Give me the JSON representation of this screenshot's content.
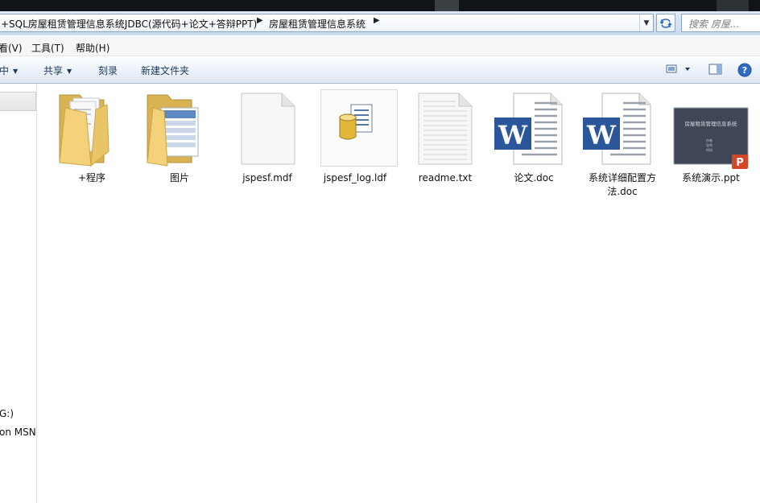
{
  "address": {
    "segment1": "+SQL房屋租赁管理信息系统JDBC(源代码+论文+答辩PPT)",
    "segment2": "房屋租赁管理信息系统",
    "search_placeholder": "搜索 房屋..."
  },
  "menu": [
    "看(V)",
    "工具(T)",
    "帮助(H)"
  ],
  "toolbar": {
    "include": "中",
    "share": "共享",
    "burn": "刻录",
    "new_folder": "新建文件夹"
  },
  "nav": {
    "drive_label": "G:)",
    "msn_label": "on MSN"
  },
  "files": [
    {
      "name": "+程序",
      "kind": "folder"
    },
    {
      "name": "图片",
      "kind": "folder-images"
    },
    {
      "name": "jspesf.mdf",
      "kind": "blank"
    },
    {
      "name": "jspesf_log.ldf",
      "kind": "database"
    },
    {
      "name": "readme.txt",
      "kind": "text"
    },
    {
      "name": "论文.doc",
      "kind": "word"
    },
    {
      "name": "系统详细配置方法.doc",
      "kind": "word"
    },
    {
      "name": "系统演示.ppt",
      "kind": "powerpoint"
    }
  ],
  "ppt_thumbnail_title": "房屋租赁管理信息系统",
  "ppt_thumbnail_lines": [
    "作者",
    "导师",
    "时间"
  ],
  "colors": {
    "word_blue": "#2b579a",
    "ppt_orange": "#d24726",
    "folder_yellow": "#f3d27a",
    "toolbar_text": "#1e395b"
  }
}
